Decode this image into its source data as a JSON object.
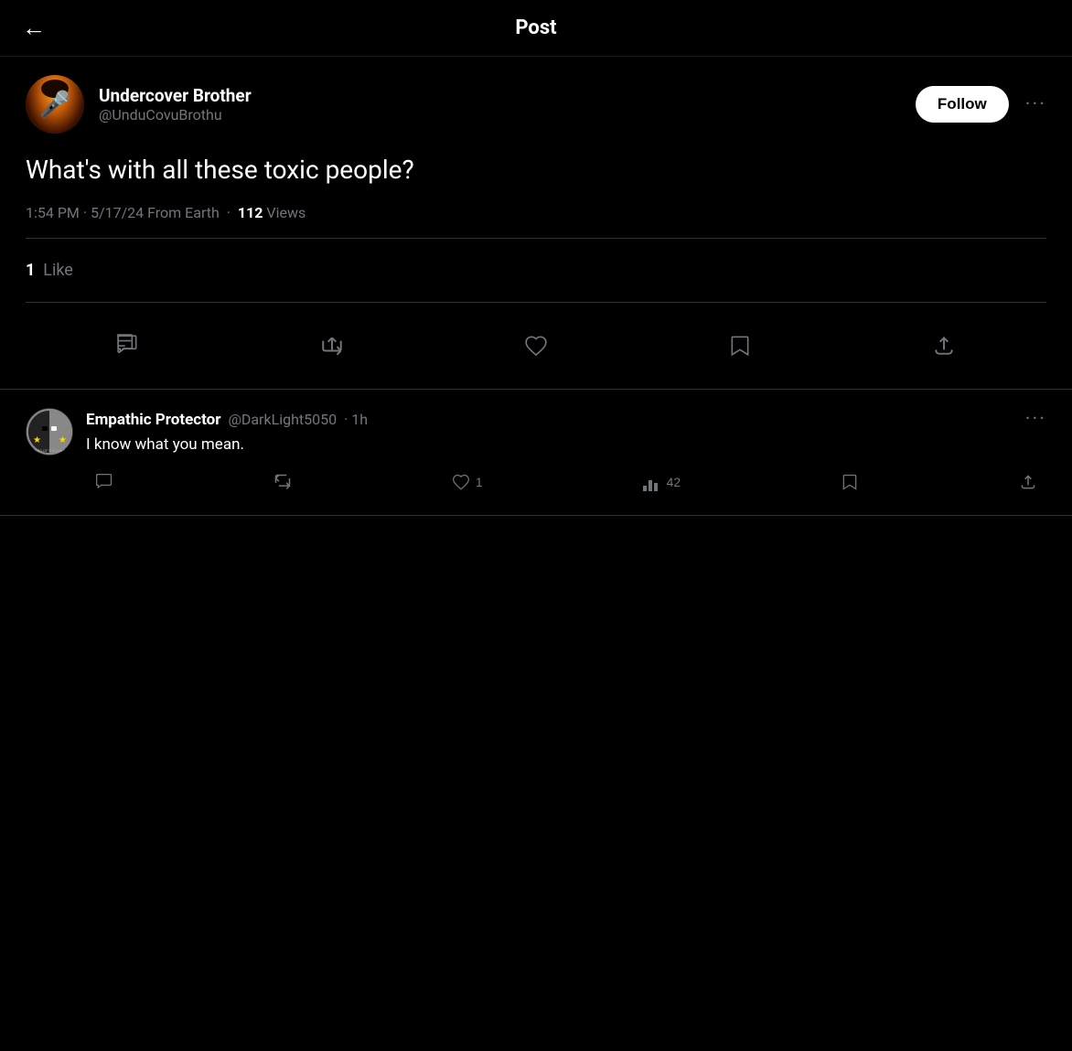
{
  "header": {
    "back_label": "←",
    "title": "Post"
  },
  "post": {
    "author": {
      "name": "Undercover Brother",
      "handle": "@UnduCovuBrothu",
      "avatar_emoji": "🎤"
    },
    "follow_label": "Follow",
    "more_label": "···",
    "text": "What's with all these toxic people?",
    "timestamp": "1:54 PM · 5/17/24 From Earth",
    "views_count": "112",
    "views_label": "Views",
    "likes_count": "1",
    "likes_label": "Like",
    "actions": {
      "reply_label": "Reply",
      "retweet_label": "Retweet",
      "like_label": "Like",
      "bookmark_label": "Bookmark",
      "share_label": "Share"
    }
  },
  "replies": [
    {
      "author_name": "Empathic Protector",
      "author_handle": "@DarkLight5050",
      "time": "1h",
      "text": "I know what you mean.",
      "likes_count": "1",
      "views_count": "42",
      "more_label": "···"
    }
  ]
}
